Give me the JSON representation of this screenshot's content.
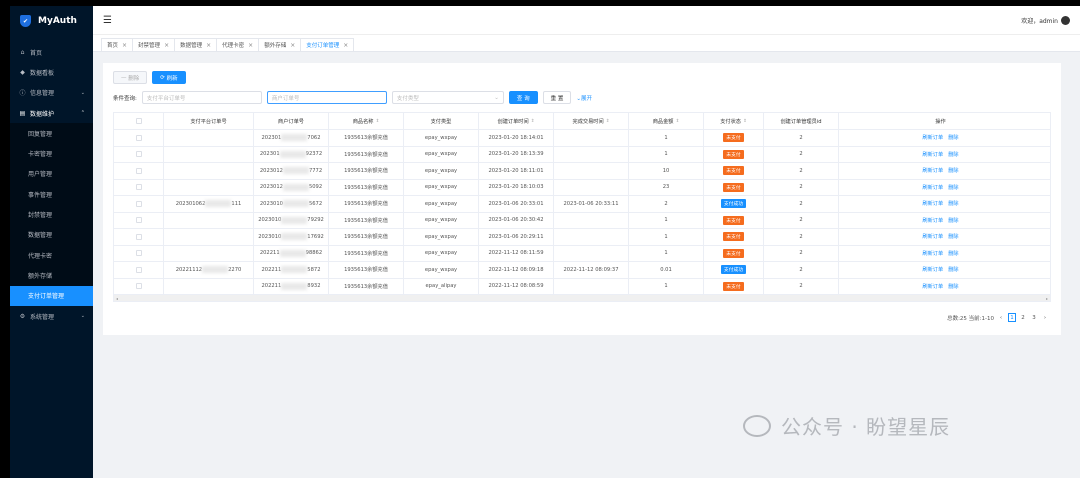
{
  "app": {
    "title": "MyAuth"
  },
  "sidebar": {
    "items": [
      {
        "label": "首页",
        "icon": "home-icon",
        "type": "top"
      },
      {
        "label": "数据看板",
        "icon": "dashboard-icon",
        "type": "top"
      },
      {
        "label": "信息管理",
        "icon": "info-icon",
        "type": "top-arrow"
      },
      {
        "label": "数据维护",
        "icon": "database-icon",
        "type": "open"
      },
      {
        "label": "回复管理",
        "type": "sub"
      },
      {
        "label": "卡密管理",
        "type": "sub"
      },
      {
        "label": "用户管理",
        "type": "sub"
      },
      {
        "label": "事件管理",
        "type": "sub"
      },
      {
        "label": "封禁管理",
        "type": "sub"
      },
      {
        "label": "数据管理",
        "type": "sub"
      },
      {
        "label": "代理卡密",
        "type": "sub"
      },
      {
        "label": "额外存储",
        "type": "sub"
      },
      {
        "label": "支付订单管理",
        "type": "sub-active"
      },
      {
        "label": "系统管理",
        "icon": "settings-icon",
        "type": "top-arrow"
      }
    ]
  },
  "header": {
    "welcome": "欢迎，admin"
  },
  "tabs": [
    "首页",
    "封禁管理",
    "数据管理",
    "代理卡密",
    "额外存储",
    "支付订单管理"
  ],
  "toolbar": {
    "delete_label": "删除",
    "refresh_label": "刷新"
  },
  "search": {
    "label": "条件查询:",
    "platform_placeholder": "支付平台订单号",
    "merchant_placeholder": "商户订单号",
    "type_placeholder": "支付类型",
    "query_label": "查 询",
    "reset_label": "重 置",
    "expand_label": "展开"
  },
  "table": {
    "columns": [
      "支付平台订单号",
      "商户订单号",
      "商品名称",
      "支付类型",
      "创建订单时间",
      "完成交易时间",
      "商品金额",
      "支付状态",
      "创建订单管理员id",
      "操作"
    ],
    "rows": [
      {
        "platform": "",
        "merchant_a": "202301",
        "merchant_b": "7062",
        "product": "1935613余额充值",
        "type": "epay_wxpay",
        "created": "2023-01-20 18:14:01",
        "completed": "",
        "amount": "1",
        "status": "未支付",
        "paid": false,
        "admin": "2"
      },
      {
        "platform": "",
        "merchant_a": "202301",
        "merchant_b": "92372",
        "product": "1935613余额充值",
        "type": "epay_wxpay",
        "created": "2023-01-20 18:13:39",
        "completed": "",
        "amount": "1",
        "status": "未支付",
        "paid": false,
        "admin": "2"
      },
      {
        "platform": "",
        "merchant_a": "2023012",
        "merchant_b": "7772",
        "product": "1935613余额充值",
        "type": "epay_wxpay",
        "created": "2023-01-20 18:11:01",
        "completed": "",
        "amount": "10",
        "status": "未支付",
        "paid": false,
        "admin": "2"
      },
      {
        "platform": "",
        "merchant_a": "2023012",
        "merchant_b": "5092",
        "product": "1935613余额充值",
        "type": "epay_wxpay",
        "created": "2023-01-20 18:10:03",
        "completed": "",
        "amount": "23",
        "status": "未支付",
        "paid": false,
        "admin": "2"
      },
      {
        "platform_a": "202301062",
        "platform_b": "111",
        "merchant_a": "2023010",
        "merchant_b": "5672",
        "product": "1935613余额充值",
        "type": "epay_wxpay",
        "created": "2023-01-06 20:33:01",
        "completed": "2023-01-06 20:33:11",
        "amount": "2",
        "status": "支付成功",
        "paid": true,
        "admin": "2"
      },
      {
        "platform": "",
        "merchant_a": "2023010",
        "merchant_b": "79292",
        "product": "1935613余额充值",
        "type": "epay_wxpay",
        "created": "2023-01-06 20:30:42",
        "completed": "",
        "amount": "1",
        "status": "未支付",
        "paid": false,
        "admin": "2"
      },
      {
        "platform": "",
        "merchant_a": "2023010",
        "merchant_b": "17692",
        "product": "1935613余额充值",
        "type": "epay_wxpay",
        "created": "2023-01-06 20:29:11",
        "completed": "",
        "amount": "1",
        "status": "未支付",
        "paid": false,
        "admin": "2"
      },
      {
        "platform": "",
        "merchant_a": "202211",
        "merchant_b": "98862",
        "product": "1935613余额充值",
        "type": "epay_wxpay",
        "created": "2022-11-12 08:11:59",
        "completed": "",
        "amount": "1",
        "status": "未支付",
        "paid": false,
        "admin": "2"
      },
      {
        "platform_a": "20221112",
        "platform_b": "2270",
        "merchant_a": "202211",
        "merchant_b": "5872",
        "product": "1935613余额充值",
        "type": "epay_wxpay",
        "created": "2022-11-12 08:09:18",
        "completed": "2022-11-12 08:09:37",
        "amount": "0.01",
        "status": "支付成功",
        "paid": true,
        "admin": "2"
      },
      {
        "platform": "",
        "merchant_a": "202211",
        "merchant_b": "8932",
        "product": "1935613余额充值",
        "type": "epay_alipay",
        "created": "2022-11-12 08:08:59",
        "completed": "",
        "amount": "1",
        "status": "未支付",
        "paid": false,
        "admin": "2"
      }
    ],
    "op_refresh": "刷新订单",
    "op_delete": "删除"
  },
  "pagination": {
    "summary": "总数:25 当前:1-10",
    "pages": [
      "1",
      "2",
      "3"
    ],
    "current": "1"
  },
  "watermark": "公众号 · 盼望星辰",
  "colors": {
    "sidebar": "#001529",
    "accent": "#1890ff",
    "unpaid": "#f56c1e"
  }
}
